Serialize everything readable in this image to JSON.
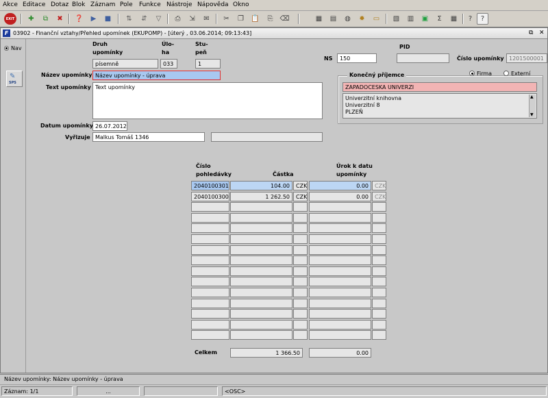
{
  "menu": [
    "Akce",
    "Editace",
    "Dotaz",
    "Blok",
    "Záznam",
    "Pole",
    "Funkce",
    "Nástroje",
    "Nápověda",
    "Okno"
  ],
  "toolbar": {
    "exit_label": "EXIT"
  },
  "window": {
    "title": "03902 - Finanční vztahy/Přehled upomínek (EKUPOMP) - [úterý  , 03.06.2014; 09:13:43]",
    "logo_text": "F",
    "restore_glyph": "⧉",
    "close_glyph": "✕"
  },
  "left_panel": {
    "nav_label": "Nav",
    "sps_label": "SPS"
  },
  "form": {
    "druh_label_1": "Druh",
    "druh_label_2": "upomínky",
    "druh_value": "písemně",
    "uloha_label_1": "Úlo-",
    "uloha_label_2": "ha",
    "uloha_value": "033",
    "stupen_label_1": "Stu-",
    "stupen_label_2": "peň",
    "stupen_value": "1",
    "ns_label": "NS",
    "ns_value": "150",
    "pid_label": "PID",
    "pid_value": "",
    "cislo_upominky_label": "Číslo upomínky",
    "cislo_upominky_value": "1201500001",
    "nazev_label": "Název upomínky",
    "nazev_value": "Název upomínky - úprava",
    "text_label": "Text upomínky",
    "text_value": "Text upomínky",
    "datum_label": "Datum upomínky",
    "datum_value": "26.07.2012",
    "vyrizuje_label": "Vyřizuje",
    "vyrizuje_value": "Malkus Tomáš 1346",
    "vyrizuje_extra": ""
  },
  "recipient": {
    "group_label": "Konečný příjemce",
    "radio_firma": "Firma",
    "radio_externi": "Externí",
    "name": "ZAPADOCESKA UNIVERZI",
    "address": [
      "Univerzitní knihovna",
      "Univerzitní 8",
      "PLZEŇ"
    ]
  },
  "table": {
    "col_cislo_1": "Číslo",
    "col_cislo_2": "pohledávky",
    "col_castka": "Částka",
    "col_urok_1": "Úrok k datu",
    "col_urok_2": "upomínky",
    "rows": [
      {
        "cislo": "2040100301",
        "castka": "104.00",
        "mena": "CZK",
        "urok": "0.00",
        "urok_mena": "CZK"
      },
      {
        "cislo": "2040100300",
        "castka": "1 262.50",
        "mena": "CZK",
        "urok": "0.00",
        "urok_mena": "CZK"
      }
    ],
    "empty_rows": 13,
    "celkem_label": "Celkem",
    "celkem_castka": "1 366.50",
    "celkem_urok": "0.00"
  },
  "status": {
    "message": "Název upomínky: Název upomínky - úprava",
    "record": "Záznam: 1/1",
    "cell2": "...",
    "cell3": "",
    "osc": "<OSC>"
  }
}
